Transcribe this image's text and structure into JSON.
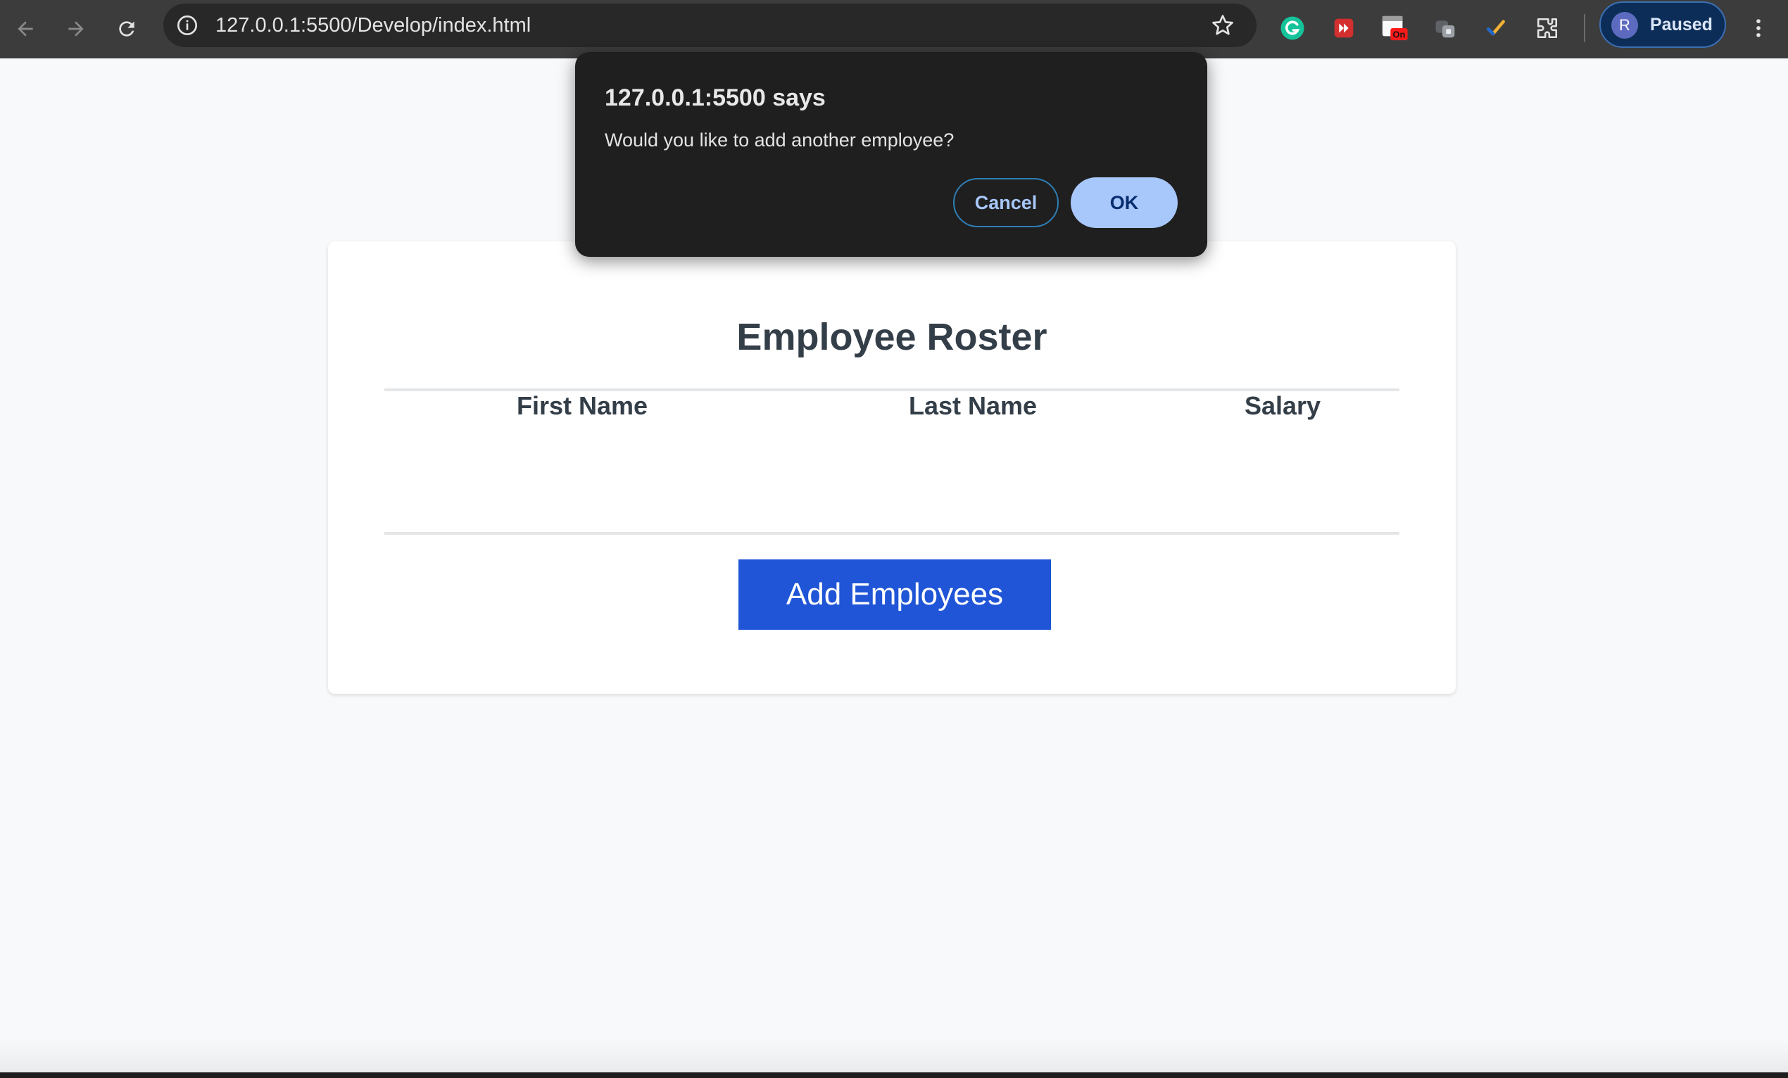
{
  "browser": {
    "url": "127.0.0.1:5500/Develop/index.html",
    "profile": {
      "initial": "R",
      "status": "Paused"
    },
    "extensions": [
      "grammarly-icon",
      "media-extension-icon",
      "calendar-on-extension-icon",
      "translate-extension-icon",
      "checkmark-extension-icon",
      "extensions-puzzle-icon"
    ],
    "extension_badge": "On"
  },
  "page": {
    "title": "Employee Roster",
    "columns": [
      "First Name",
      "Last Name",
      "Salary"
    ],
    "rows": [],
    "add_button": "Add Employees"
  },
  "dialog": {
    "title": "127.0.0.1:5500 says",
    "message": "Would you like to add another employee?",
    "cancel_label": "Cancel",
    "ok_label": "OK"
  },
  "colors": {
    "accent_button": "#1f55d6",
    "dialog_ok": "#a8c7fa",
    "heading_text": "#333e48"
  }
}
